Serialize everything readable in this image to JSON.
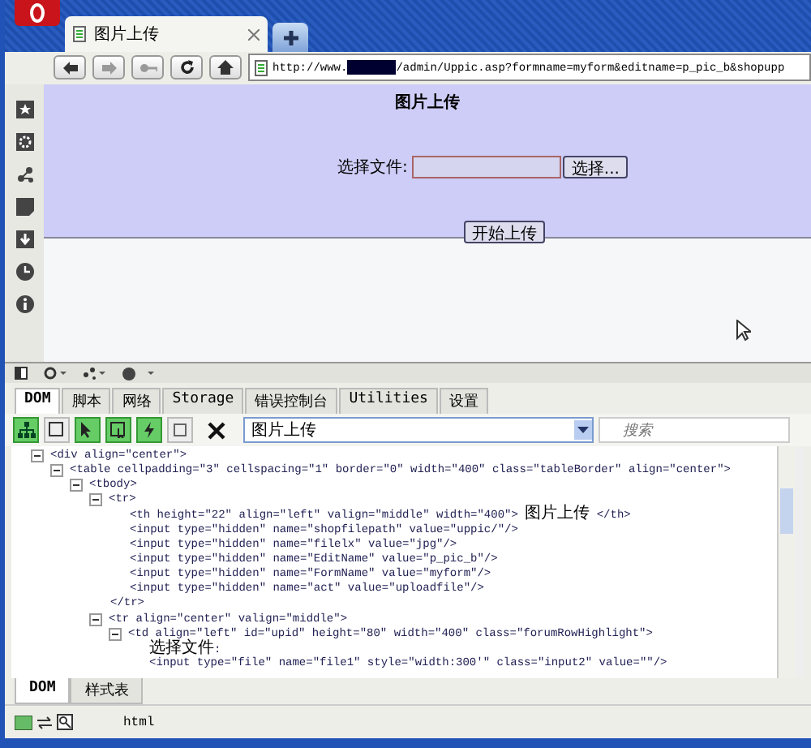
{
  "browser": {
    "tabs": [
      {
        "title": "图片上传",
        "selected": true
      }
    ],
    "address": {
      "prefix": "http://www.",
      "redacted": true,
      "suffix": "/admin/Uppic.asp?formname=myform&editname=p_pic_b&shopupp"
    }
  },
  "page": {
    "heading": "图片上传",
    "file_label": "选择文件:",
    "browse_button": "选择...",
    "submit_button": "开始上传"
  },
  "devtools": {
    "tabs": [
      {
        "label": "DOM",
        "selected": true
      },
      {
        "label": "脚本",
        "selected": false
      },
      {
        "label": "网络",
        "selected": false
      },
      {
        "label": "Storage",
        "selected": false
      },
      {
        "label": "错误控制台",
        "selected": false
      },
      {
        "label": "Utilities",
        "selected": false
      },
      {
        "label": "设置",
        "selected": false
      }
    ],
    "tools": [
      {
        "kind": "tree",
        "on": true
      },
      {
        "kind": "frame",
        "on": false
      },
      {
        "kind": "pointer",
        "on": true
      },
      {
        "kind": "inspect",
        "on": true
      },
      {
        "kind": "flash",
        "on": true
      },
      {
        "kind": "square",
        "on": false
      }
    ],
    "document_select": "图片上传",
    "search": {
      "placeholder": "搜索"
    },
    "tree": [
      {
        "text": "<div align=\"center\">",
        "expanded": true,
        "children": [
          {
            "text": "<table cellpadding=\"3\" cellspacing=\"1\" border=\"0\" width=\"400\" class=\"tableBorder\" align=\"center\">",
            "expanded": true,
            "children": [
              {
                "text": "<tbody>",
                "expanded": true,
                "children": [
                  {
                    "text": "<tr>",
                    "expanded": true,
                    "children": [
                      {
                        "text": "<th height=\"22\" align=\"left\" valign=\"middle\" width=\"400\"> 图片上传 </th>"
                      },
                      {
                        "text": "<input type=\"hidden\" name=\"shopfilepath\" value=\"uppic/\"/>"
                      },
                      {
                        "text": "<input type=\"hidden\" name=\"filelx\" value=\"jpg\"/>"
                      },
                      {
                        "text": "<input type=\"hidden\" name=\"EditName\" value=\"p_pic_b\"/>"
                      },
                      {
                        "text": "<input type=\"hidden\" name=\"FormName\" value=\"myform\"/>"
                      },
                      {
                        "text": "<input type=\"hidden\" name=\"act\" value=\"uploadfile\"/>"
                      }
                    ]
                  },
                  {
                    "text": "</tr>"
                  },
                  {
                    "text": "<tr align=\"center\" valign=\"middle\">",
                    "expanded": true,
                    "children": [
                      {
                        "text": "<td align=\"left\" id=\"upid\" height=\"80\" width=\"400\" class=\"forumRowHighlight\">",
                        "expanded": true,
                        "children": [
                          {
                            "text": "选择文件:"
                          },
                          {
                            "text": "<input type=\"file\" name=\"file1\" style=\"width:300'\" class=\"input2\" value=\"\"/>"
                          }
                        ]
                      }
                    ]
                  }
                ]
              }
            ]
          }
        ]
      }
    ],
    "bottom_tabs": [
      {
        "label": "DOM",
        "selected": true
      },
      {
        "label": "样式表",
        "selected": false
      }
    ],
    "status": "html"
  }
}
